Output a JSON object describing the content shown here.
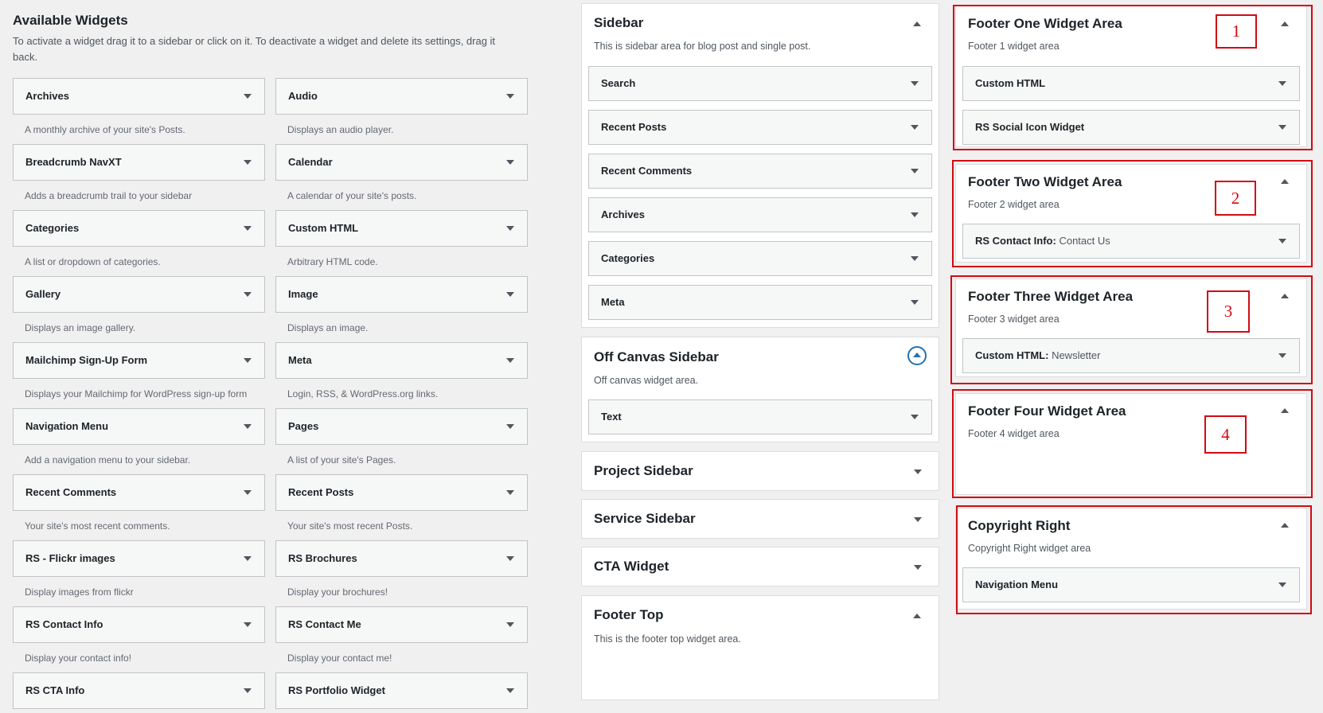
{
  "available": {
    "title": "Available Widgets",
    "intro": "To activate a widget drag it to a sidebar or click on it. To deactivate a widget and delete its settings, drag it back.",
    "widgets": [
      {
        "name": "Archives",
        "desc": "A monthly archive of your site's Posts."
      },
      {
        "name": "Audio",
        "desc": "Displays an audio player."
      },
      {
        "name": "Breadcrumb NavXT",
        "desc": "Adds a breadcrumb trail to your sidebar"
      },
      {
        "name": "Calendar",
        "desc": "A calendar of your site's posts."
      },
      {
        "name": "Categories",
        "desc": "A list or dropdown of categories."
      },
      {
        "name": "Custom HTML",
        "desc": "Arbitrary HTML code."
      },
      {
        "name": "Gallery",
        "desc": "Displays an image gallery."
      },
      {
        "name": "Image",
        "desc": "Displays an image."
      },
      {
        "name": "Mailchimp Sign-Up Form",
        "desc": "Displays your Mailchimp for WordPress sign-up form"
      },
      {
        "name": "Meta",
        "desc": "Login, RSS, & WordPress.org links."
      },
      {
        "name": "Navigation Menu",
        "desc": "Add a navigation menu to your sidebar."
      },
      {
        "name": "Pages",
        "desc": "A list of your site's Pages."
      },
      {
        "name": "Recent Comments",
        "desc": "Your site's most recent comments."
      },
      {
        "name": "Recent Posts",
        "desc": "Your site's most recent Posts."
      },
      {
        "name": "RS - Flickr images",
        "desc": "Display images from flickr"
      },
      {
        "name": "RS Brochures",
        "desc": "Display your brochures!"
      },
      {
        "name": "RS Contact Info",
        "desc": "Display your contact info!"
      },
      {
        "name": "RS Contact Me",
        "desc": "Display your contact me!"
      },
      {
        "name": "RS CTA Info",
        "desc": ""
      },
      {
        "name": "RS Portfolio Widget",
        "desc": ""
      }
    ]
  },
  "sidebar": {
    "title": "Sidebar",
    "desc": "This is sidebar area for blog post and single post.",
    "widgets": [
      "Search",
      "Recent Posts",
      "Recent Comments",
      "Archives",
      "Categories",
      "Meta"
    ]
  },
  "off_canvas": {
    "title": "Off Canvas Sidebar",
    "desc": "Off canvas widget area.",
    "widgets": [
      "Text"
    ]
  },
  "project_sidebar": {
    "title": "Project Sidebar"
  },
  "service_sidebar": {
    "title": "Service Sidebar"
  },
  "cta_widget": {
    "title": "CTA Widget"
  },
  "footer_top": {
    "title": "Footer Top",
    "desc": "This is the footer top widget area."
  },
  "footer_one": {
    "title": "Footer One Widget Area",
    "desc": "Footer 1 widget area",
    "widgets": [
      "Custom HTML",
      "RS Social Icon Widget"
    ],
    "marker": "1"
  },
  "footer_two": {
    "title": "Footer Two Widget Area",
    "desc": "Footer 2 widget area",
    "widget_name": "RS Contact Info:",
    "widget_sub": "Contact Us",
    "marker": "2"
  },
  "footer_three": {
    "title": "Footer Three Widget Area",
    "desc": "Footer 3 widget area",
    "widget_name": "Custom HTML:",
    "widget_sub": "Newsletter",
    "marker": "3"
  },
  "footer_four": {
    "title": "Footer Four Widget Area",
    "desc": "Footer 4 widget area",
    "marker": "4"
  },
  "copyright": {
    "title": "Copyright Right",
    "desc": "Copyright Right widget area",
    "widgets": [
      "Navigation Menu"
    ]
  },
  "colors": {
    "annotation": "#d20a11",
    "accent": "#2271b1",
    "background": "#f0f0f1"
  }
}
